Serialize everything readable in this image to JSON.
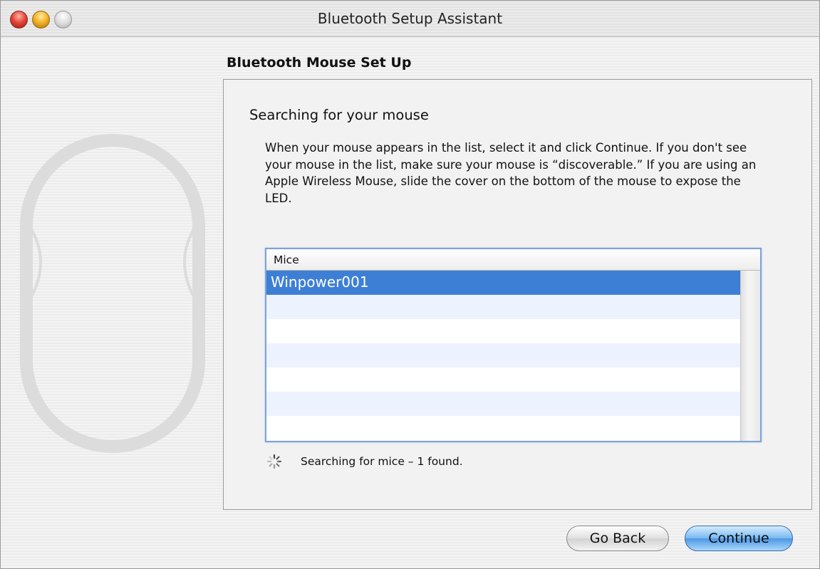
{
  "window": {
    "title": "Bluetooth Setup Assistant"
  },
  "page": {
    "section_title": "Bluetooth Mouse Set Up"
  },
  "panel": {
    "heading": "Searching for your mouse",
    "description": "When your mouse appears in the list, select it and click Continue. If you don't see your mouse in the list, make sure your mouse is “discoverable.”  If you are using an Apple Wireless Mouse, slide the cover on the bottom of the mouse to expose the LED."
  },
  "list": {
    "header": "Mice",
    "items": [
      "Winpower001"
    ],
    "selected_index": 0
  },
  "status": {
    "text": "Searching for mice – 1 found."
  },
  "buttons": {
    "go_back": "Go Back",
    "continue": "Continue"
  },
  "icons": {
    "close": "close-icon",
    "minimize": "minimize-icon",
    "zoom": "zoom-icon",
    "spinner": "progress-spinner-icon",
    "illustration": "bluetooth-mouse-illustration"
  },
  "colors": {
    "selection": "#3e7fd6",
    "list_border": "#7fa3d6",
    "default_button": "#4f98e4"
  }
}
